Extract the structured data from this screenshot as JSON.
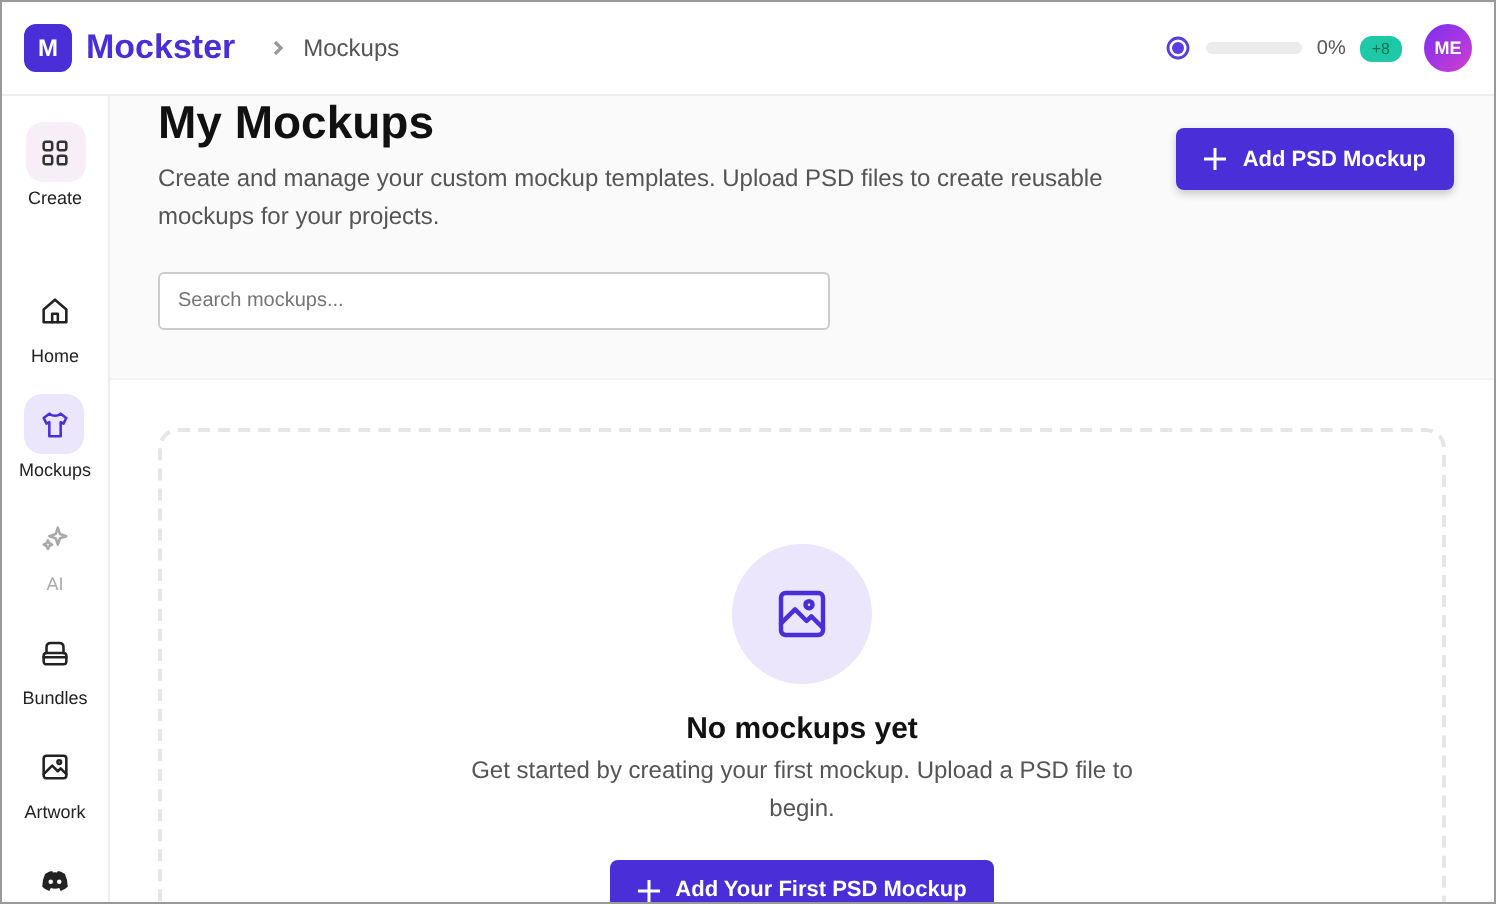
{
  "header": {
    "logo_letter": "M",
    "brand": "Mockster",
    "breadcrumb": "Mockups",
    "credits": {
      "level": 0,
      "reading": "0%",
      "badge": "+8"
    },
    "avatar": "ME"
  },
  "sidebar": {
    "items": [
      {
        "kind": "create",
        "label": "Create",
        "selected": false,
        "disabled": false
      },
      {
        "kind": "home",
        "label": "Home",
        "selected": false,
        "disabled": false
      },
      {
        "kind": "shirt",
        "label": "Mockups",
        "selected": true,
        "disabled": false
      },
      {
        "kind": "sparkle",
        "label": "AI",
        "selected": false,
        "disabled": true
      },
      {
        "kind": "bundle",
        "label": "Bundles",
        "selected": false,
        "disabled": false
      },
      {
        "kind": "image",
        "label": "Artwork",
        "selected": false,
        "disabled": false
      },
      {
        "kind": "discord",
        "selected": false,
        "disabled": false
      }
    ]
  },
  "page": {
    "title": "My Mockups",
    "description": "Create and manage your custom mockup templates. Upload PSD files to create reusable mockups for your projects.",
    "add_button": "Add PSD Mockup",
    "search": {
      "placeholder": "Search mockups..."
    }
  },
  "empty_state": {
    "title": "No mockups yet",
    "message": "Get started by creating your first mockup. Upload a PSD file to begin.",
    "button": "Add Your First PSD Mockup"
  }
}
